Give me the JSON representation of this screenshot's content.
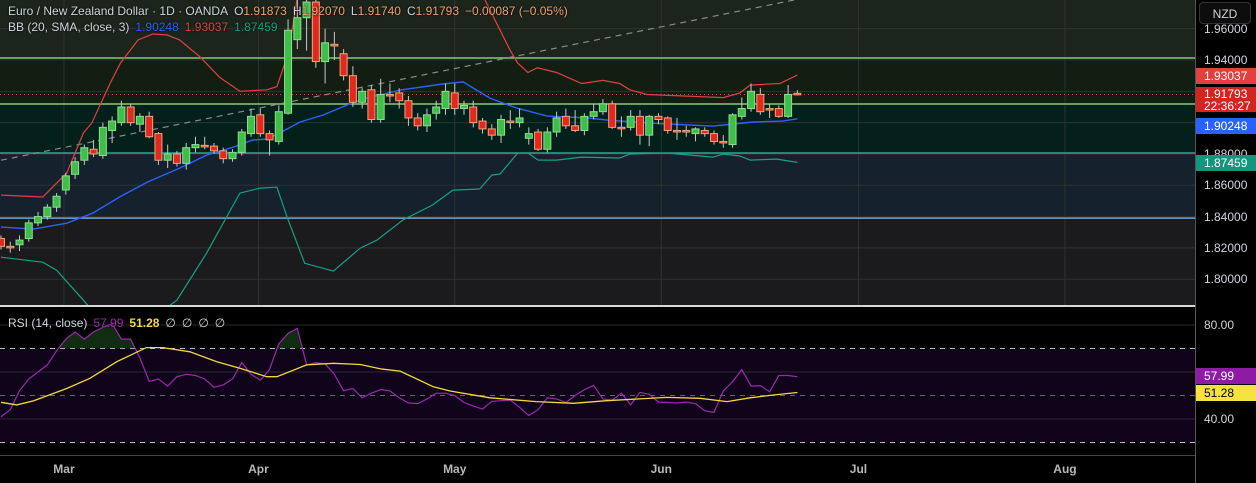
{
  "header": {
    "symbol": "Euro / New Zealand Dollar · 1D · OANDA",
    "o_label": "O",
    "o": "1.91873",
    "h_label": "H",
    "h": "1.92070",
    "l_label": "L",
    "l": "1.91740",
    "c_label": "C",
    "c": "1.91793",
    "change": "−0.00087 (−0.05%)"
  },
  "bb_legend": {
    "name": "BB (20, SMA, close, 3)",
    "basis": "1.90248",
    "upper": "1.93037",
    "lower": "1.87459"
  },
  "rsi_legend": {
    "name": "RSI (14, close)",
    "rsi": "57.99",
    "ma": "51.28",
    "empty": [
      "∅",
      "∅",
      "∅",
      "∅"
    ]
  },
  "currency_button": "NZD",
  "price_axis": {
    "labels": [
      "1.96000",
      "1.94000",
      "1.88000",
      "1.86000",
      "1.84000",
      "1.82000",
      "1.80000"
    ],
    "label_values": [
      1.96,
      1.94,
      1.88,
      1.86,
      1.84,
      1.82,
      1.8
    ],
    "current_price": "1.91793",
    "countdown": "22:36:27"
  },
  "rsi_axis": {
    "labels": [
      "80.00",
      "40.00"
    ],
    "label_values": [
      80,
      40
    ]
  },
  "colors": {
    "up": "#3fbf4a",
    "up_border": "#8fdc8f",
    "down": "#e0291f",
    "down_border": "#f5a37a",
    "bb_upper": "#e2403f",
    "bb_basis": "#2962ff",
    "bb_lower": "#17a086",
    "rsi": "#9c27b0",
    "rsi_ma": "#f5d63d"
  },
  "chart_data": [
    {
      "type": "candlestick",
      "title": "Euro / New Zealand Dollar · 1D · OANDA",
      "x_ticks": [
        {
          "label": "Mar",
          "index": 6.8
        },
        {
          "label": "Apr",
          "index": 27.8
        },
        {
          "label": "May",
          "index": 49
        },
        {
          "label": "Jun",
          "index": 71.3
        },
        {
          "label": "Jul",
          "index": 92.6
        },
        {
          "label": "Aug",
          "index": 114.9
        }
      ],
      "ylim": [
        1.78,
        1.98
      ],
      "ohlc": [
        [
          1.826,
          1.828,
          1.819,
          1.821
        ],
        [
          1.821,
          1.824,
          1.817,
          1.821
        ],
        [
          1.822,
          1.828,
          1.818,
          1.825
        ],
        [
          1.826,
          1.838,
          1.824,
          1.836
        ],
        [
          1.836,
          1.843,
          1.834,
          1.84
        ],
        [
          1.84,
          1.848,
          1.838,
          1.846
        ],
        [
          1.846,
          1.855,
          1.843,
          1.853
        ],
        [
          1.857,
          1.868,
          1.854,
          1.866
        ],
        [
          1.867,
          1.878,
          1.864,
          1.875
        ],
        [
          1.876,
          1.886,
          1.873,
          1.884
        ],
        [
          1.883,
          1.889,
          1.878,
          1.88
        ],
        [
          1.879,
          1.9,
          1.877,
          1.897
        ],
        [
          1.895,
          1.904,
          1.887,
          1.901
        ],
        [
          1.9,
          1.914,
          1.898,
          1.91
        ],
        [
          1.91,
          1.912,
          1.898,
          1.9
        ],
        [
          1.899,
          1.906,
          1.894,
          1.904
        ],
        [
          1.904,
          1.907,
          1.89,
          1.891
        ],
        [
          1.893,
          1.894,
          1.873,
          1.876
        ],
        [
          1.876,
          1.886,
          1.871,
          1.88
        ],
        [
          1.88,
          1.882,
          1.872,
          1.874
        ],
        [
          1.874,
          1.887,
          1.87,
          1.884
        ],
        [
          1.884,
          1.891,
          1.881,
          1.886
        ],
        [
          1.8855,
          1.891,
          1.883,
          1.885
        ],
        [
          1.885,
          1.887,
          1.88,
          1.882
        ],
        [
          1.882,
          1.884,
          1.874,
          1.877
        ],
        [
          1.877,
          1.883,
          1.875,
          1.881
        ],
        [
          1.881,
          1.896,
          1.879,
          1.894
        ],
        [
          1.893,
          1.909,
          1.891,
          1.904
        ],
        [
          1.905,
          1.909,
          1.891,
          1.893
        ],
        [
          1.893,
          1.895,
          1.879,
          1.889
        ],
        [
          1.888,
          1.911,
          1.886,
          1.907
        ],
        [
          1.906,
          1.966,
          1.905,
          1.959
        ],
        [
          1.953,
          1.98,
          1.947,
          1.967
        ],
        [
          1.967,
          1.985,
          1.946,
          1.977
        ],
        [
          1.977,
          1.985,
          1.935,
          1.939
        ],
        [
          1.939,
          1.96,
          1.925,
          1.951
        ],
        [
          1.95,
          1.958,
          1.94,
          1.949
        ],
        [
          1.944,
          1.947,
          1.927,
          1.93
        ],
        [
          1.93,
          1.936,
          1.91,
          1.913
        ],
        [
          1.913,
          1.922,
          1.909,
          1.92
        ],
        [
          1.921,
          1.924,
          1.9,
          1.902
        ],
        [
          1.902,
          1.928,
          1.9,
          1.918
        ],
        [
          1.918,
          1.925,
          1.913,
          1.918
        ],
        [
          1.919,
          1.922,
          1.909,
          1.914
        ],
        [
          1.914,
          1.917,
          1.898,
          1.903
        ],
        [
          1.903,
          1.906,
          1.895,
          1.898
        ],
        [
          1.898,
          1.909,
          1.894,
          1.905
        ],
        [
          1.906,
          1.914,
          1.902,
          1.91
        ],
        [
          1.909,
          1.925,
          1.905,
          1.92
        ],
        [
          1.919,
          1.925,
          1.905,
          1.909
        ],
        [
          1.909,
          1.914,
          1.905,
          1.911
        ],
        [
          1.91,
          1.914,
          1.897,
          1.9
        ],
        [
          1.901,
          1.903,
          1.893,
          1.896
        ],
        [
          1.896,
          1.899,
          1.889,
          1.892
        ],
        [
          1.892,
          1.905,
          1.887,
          1.902
        ],
        [
          1.901,
          1.908,
          1.896,
          1.901
        ],
        [
          1.9,
          1.909,
          1.897,
          1.903
        ],
        [
          1.89,
          1.897,
          1.886,
          1.893
        ],
        [
          1.894,
          1.896,
          1.882,
          1.883
        ],
        [
          1.883,
          1.897,
          1.881,
          1.894
        ],
        [
          1.894,
          1.907,
          1.891,
          1.903
        ],
        [
          1.904,
          1.909,
          1.896,
          1.898
        ],
        [
          1.898,
          1.908,
          1.894,
          1.895
        ],
        [
          1.895,
          1.906,
          1.892,
          1.904
        ],
        [
          1.904,
          1.912,
          1.902,
          1.907
        ],
        [
          1.907,
          1.915,
          1.905,
          1.912
        ],
        [
          1.912,
          1.914,
          1.896,
          1.897
        ],
        [
          1.897,
          1.904,
          1.891,
          1.897
        ],
        [
          1.897,
          1.908,
          1.895,
          1.904
        ],
        [
          1.904,
          1.908,
          1.886,
          1.892
        ],
        [
          1.892,
          1.905,
          1.885,
          1.904
        ],
        [
          1.904,
          1.906,
          1.899,
          1.902
        ],
        [
          1.903,
          1.904,
          1.893,
          1.895
        ],
        [
          1.895,
          1.903,
          1.889,
          1.895
        ],
        [
          1.895,
          1.898,
          1.891,
          1.894
        ],
        [
          1.893,
          1.897,
          1.888,
          1.896
        ],
        [
          1.895,
          1.897,
          1.891,
          1.893
        ],
        [
          1.893,
          1.895,
          1.886,
          1.888
        ],
        [
          1.888,
          1.892,
          1.884,
          1.888
        ],
        [
          1.886,
          1.906,
          1.884,
          1.905
        ],
        [
          1.904,
          1.916,
          1.902,
          1.909
        ],
        [
          1.909,
          1.925,
          1.907,
          1.92
        ],
        [
          1.918,
          1.922,
          1.905,
          1.907
        ],
        [
          1.909,
          1.912,
          1.903,
          1.909
        ],
        [
          1.909,
          1.911,
          1.903,
          1.904
        ],
        [
          1.904,
          1.924,
          1.903,
          1.918
        ],
        [
          1.91873,
          1.9207,
          1.9174,
          1.91793
        ]
      ],
      "bb_upper": [
        [
          0,
          1.8537
        ],
        [
          4.5,
          1.8525
        ],
        [
          7.1,
          1.8678
        ],
        [
          8.9,
          1.8934
        ],
        [
          9.8,
          1.8997
        ],
        [
          11.8,
          1.9253
        ],
        [
          12.9,
          1.9381
        ],
        [
          14.8,
          1.9528
        ],
        [
          16.4,
          1.9566
        ],
        [
          17.9,
          1.956
        ],
        [
          19.3,
          1.9528
        ],
        [
          21.5,
          1.942
        ],
        [
          23.6,
          1.929
        ],
        [
          25.8,
          1.92
        ],
        [
          28.7,
          1.921
        ],
        [
          29.8,
          1.923
        ],
        [
          30.9,
          1.942
        ],
        [
          31.5,
          1.961
        ],
        [
          32.3,
          1.991
        ],
        [
          37.7,
          2.017
        ],
        [
          45.2,
          2.01
        ],
        [
          51.7,
          1.985
        ],
        [
          55,
          1.946
        ],
        [
          55.8,
          1.938
        ],
        [
          56.9,
          1.932
        ],
        [
          57.9,
          1.935
        ],
        [
          60,
          1.932
        ],
        [
          62.7,
          1.925
        ],
        [
          65,
          1.927
        ],
        [
          66.8,
          1.925
        ],
        [
          67.9,
          1.921
        ],
        [
          69.8,
          1.918
        ],
        [
          78,
          1.916
        ],
        [
          79.8,
          1.919
        ],
        [
          80.9,
          1.924
        ],
        [
          84.1,
          1.925
        ],
        [
          86,
          1.93037
        ]
      ],
      "bb_basis": [
        [
          0,
          1.8333
        ],
        [
          3.5,
          1.832
        ],
        [
          7.1,
          1.8358
        ],
        [
          9.9,
          1.8422
        ],
        [
          12.8,
          1.8525
        ],
        [
          15.8,
          1.862
        ],
        [
          19.3,
          1.871
        ],
        [
          22.2,
          1.8793
        ],
        [
          25.1,
          1.8844
        ],
        [
          27.2,
          1.8889
        ],
        [
          28.7,
          1.8895
        ],
        [
          30.1,
          1.8934
        ],
        [
          32.3,
          1.9004
        ],
        [
          34.8,
          1.9049
        ],
        [
          37.4,
          1.9113
        ],
        [
          39.5,
          1.9157
        ],
        [
          43.1,
          1.9208
        ],
        [
          47.7,
          1.9247
        ],
        [
          49.9,
          1.926
        ],
        [
          52.8,
          1.9157
        ],
        [
          55.7,
          1.9093
        ],
        [
          59,
          1.9042
        ],
        [
          63.3,
          1.903
        ],
        [
          65.4,
          1.9017
        ],
        [
          68.3,
          1.9004
        ],
        [
          71.9,
          1.8991
        ],
        [
          76.9,
          1.8978
        ],
        [
          79.1,
          1.8991
        ],
        [
          81.2,
          1.9004
        ],
        [
          84.4,
          1.901
        ],
        [
          86,
          1.90248
        ]
      ],
      "bb_lower": [
        [
          0,
          1.8141
        ],
        [
          4.5,
          1.8109
        ],
        [
          6,
          1.8058
        ],
        [
          8.9,
          1.7866
        ],
        [
          10.7,
          1.7739
        ],
        [
          16.1,
          1.7739
        ],
        [
          19,
          1.7866
        ],
        [
          22.2,
          1.8167
        ],
        [
          25.8,
          1.855
        ],
        [
          28,
          1.8582
        ],
        [
          29.8,
          1.8588
        ],
        [
          30.9,
          1.8397
        ],
        [
          32.8,
          1.8102
        ],
        [
          35.9,
          1.8052
        ],
        [
          38.8,
          1.8199
        ],
        [
          40.6,
          1.825
        ],
        [
          43.4,
          1.8378
        ],
        [
          46.6,
          1.8474
        ],
        [
          48.8,
          1.8569
        ],
        [
          51.7,
          1.8576
        ],
        [
          53,
          1.8665
        ],
        [
          53.9,
          1.8672
        ],
        [
          55.8,
          1.8806
        ],
        [
          56.9,
          1.8806
        ],
        [
          58,
          1.8761
        ],
        [
          60,
          1.8761
        ],
        [
          62.7,
          1.878
        ],
        [
          66.8,
          1.8774
        ],
        [
          67.9,
          1.8799
        ],
        [
          71.9,
          1.8806
        ],
        [
          76.9,
          1.878
        ],
        [
          78,
          1.8799
        ],
        [
          79.8,
          1.8787
        ],
        [
          80.9,
          1.8761
        ],
        [
          83.8,
          1.8767
        ],
        [
          86,
          1.87459
        ]
      ],
      "zones": [
        {
          "from": 1.9413,
          "to": 2.2,
          "fill": "#1c251c"
        },
        {
          "from": 1.9119,
          "to": 1.9413,
          "fill": "#131e13"
        },
        {
          "from": 1.8806,
          "to": 1.9119,
          "fill": "#04201b"
        },
        {
          "from": 1.839,
          "to": 1.8806,
          "fill": "#15212d"
        },
        {
          "from": 1.5,
          "to": 1.839,
          "fill": "#1b1b1d"
        }
      ],
      "levels": [
        {
          "price": 1.9413,
          "color": "#86c97a"
        },
        {
          "price": 1.9119,
          "color": "#86c97a"
        },
        {
          "price": 1.8806,
          "color": "#2aa596"
        },
        {
          "price": 1.839,
          "color": "#6aa7e0"
        }
      ],
      "trendline": [
        [
          0,
          1.876
        ],
        [
          45.2,
          1.93
        ]
      ],
      "current_price_value": 1.91793
    },
    {
      "type": "line",
      "title": "RSI (14, close)",
      "ylim": [
        24,
        86
      ],
      "bands": {
        "upper": 70,
        "middle": 50,
        "lower": 30
      },
      "rsi": [
        41,
        44,
        52,
        57,
        60,
        63,
        69,
        74,
        77,
        74,
        77,
        79,
        80.5,
        74,
        74,
        66,
        56,
        57,
        54,
        58,
        59,
        58.5,
        57,
        53.5,
        54.5,
        57,
        64,
        59,
        56.5,
        61,
        72,
        76.5,
        78.5,
        63,
        64,
        63.5,
        59,
        52,
        53,
        49,
        51,
        52.5,
        52,
        49,
        46.8,
        46.5,
        48.5,
        51,
        51,
        50,
        47,
        45.5,
        44.2,
        47.5,
        47.8,
        48,
        45,
        41.5,
        44,
        49,
        48.5,
        47,
        50,
        52.5,
        54.3,
        48.5,
        48,
        51,
        46,
        51.3,
        50.5,
        47.2,
        47,
        46.8,
        47.2,
        46.5,
        43.5,
        42.8,
        52,
        55.8,
        61,
        54,
        54.2,
        51.6,
        58.5,
        58.5,
        57.99
      ],
      "rsi_ma": [
        [
          0,
          47.1
        ],
        [
          1.7,
          46
        ],
        [
          3.5,
          47.7
        ],
        [
          7.1,
          53
        ],
        [
          9.6,
          57.3
        ],
        [
          12.5,
          64.4
        ],
        [
          15.7,
          70.4
        ],
        [
          17.5,
          70.4
        ],
        [
          20.4,
          68.6
        ],
        [
          23.3,
          64.4
        ],
        [
          25.8,
          61.6
        ],
        [
          28.7,
          58
        ],
        [
          29.8,
          58
        ],
        [
          33,
          63
        ],
        [
          35.9,
          63.7
        ],
        [
          38.8,
          63.2
        ],
        [
          41,
          61.3
        ],
        [
          43.1,
          60.4
        ],
        [
          46.7,
          53.7
        ],
        [
          48.5,
          51.9
        ],
        [
          52.8,
          49
        ],
        [
          57.8,
          47.4
        ],
        [
          61.8,
          46.7
        ],
        [
          65.4,
          47.8
        ],
        [
          71.9,
          49.2
        ],
        [
          75.5,
          48.8
        ],
        [
          78.4,
          47.4
        ],
        [
          80.9,
          49
        ],
        [
          83.4,
          50.2
        ],
        [
          86,
          51.28
        ]
      ]
    }
  ]
}
